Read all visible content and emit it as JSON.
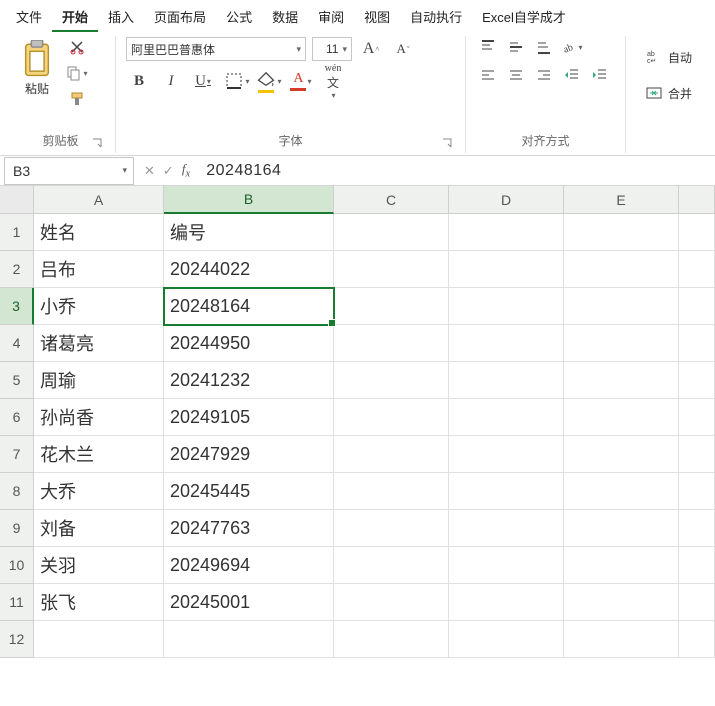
{
  "menu": {
    "items": [
      "文件",
      "开始",
      "插入",
      "页面布局",
      "公式",
      "数据",
      "审阅",
      "视图",
      "自动执行",
      "Excel自学成才"
    ],
    "active_index": 1
  },
  "ribbon": {
    "clipboard": {
      "paste": "粘贴",
      "label": "剪贴板"
    },
    "font": {
      "name": "阿里巴巴普惠体",
      "size": "11",
      "wen": "wén",
      "label": "字体"
    },
    "align": {
      "wrap": "自动",
      "merge": "合并",
      "label": "对齐方式"
    }
  },
  "name_box": "B3",
  "formula": "20248164",
  "chart_data": {
    "type": "table",
    "columns": [
      "A",
      "B",
      "C",
      "D",
      "E"
    ],
    "headers": [
      "姓名",
      "编号"
    ],
    "rows": [
      [
        "吕布",
        "20244022"
      ],
      [
        "小乔",
        "20248164"
      ],
      [
        "诸葛亮",
        "20244950"
      ],
      [
        "周瑜",
        "20241232"
      ],
      [
        "孙尚香",
        "20249105"
      ],
      [
        "花木兰",
        "20247929"
      ],
      [
        "大乔",
        "20245445"
      ],
      [
        "刘备",
        "20247763"
      ],
      [
        "关羽",
        "20249694"
      ],
      [
        "张飞",
        "20245001"
      ]
    ],
    "selected": {
      "col": 1,
      "row": 2
    }
  },
  "colors": {
    "accent": "#187b30",
    "font_color": "#d63a2b",
    "fill_color": "#f2c200"
  }
}
